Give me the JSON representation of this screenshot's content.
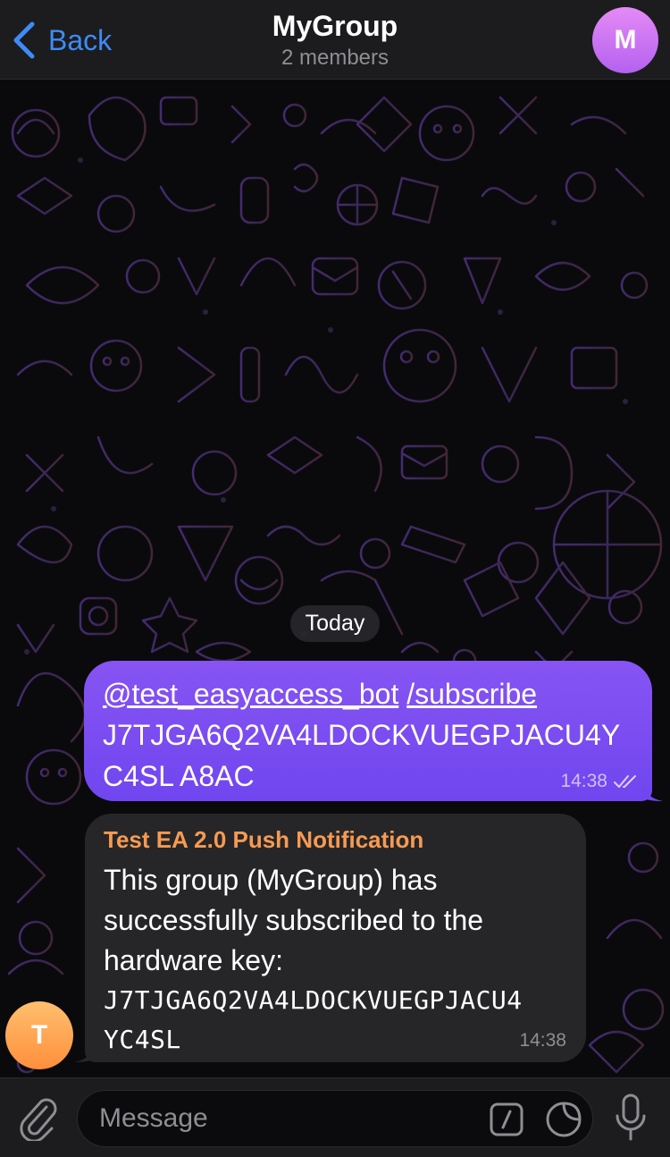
{
  "header": {
    "back_label": "Back",
    "title": "MyGroup",
    "subtitle": "2 members",
    "avatar_letter": "M"
  },
  "chat": {
    "date_label": "Today",
    "outgoing": {
      "mention": "@test_easyaccess_bot",
      "command": "/subscribe",
      "line2": "J7TJGA6Q2VA4LDOCKVUEGPJACU4Y",
      "line3": "C4SL A8AC",
      "time": "14:38",
      "status": "read"
    },
    "incoming": {
      "sender": "Test EA 2.0 Push Notification",
      "lines": [
        "This group (MyGroup) has",
        "successfully subscribed to the",
        "hardware key:"
      ],
      "key_lines": [
        "J7TJGA6Q2VA4LDOCKVUEGPJACU4",
        "YC4SL"
      ],
      "time": "14:38",
      "avatar_letter": "T"
    }
  },
  "composer": {
    "placeholder": "Message"
  },
  "icons": {
    "back": "chevron-left-icon",
    "attach": "paperclip-icon",
    "commands": "slash-command-icon",
    "sticker": "sticker-icon",
    "mic": "microphone-icon",
    "read": "double-check-icon"
  },
  "colors": {
    "accent": "#3e8bf6",
    "outgoing_bubble": "#7b4df1",
    "incoming_bubble": "#262628",
    "sender_name": "#f79a52"
  }
}
